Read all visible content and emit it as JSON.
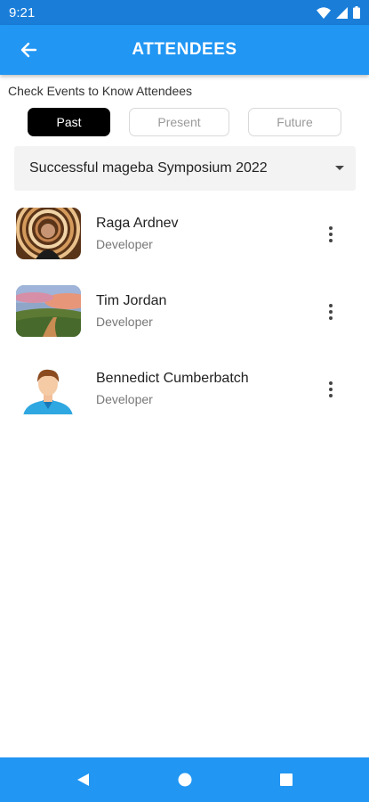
{
  "status_bar": {
    "time": "9:21"
  },
  "app_bar": {
    "title": "ATTENDEES"
  },
  "filter": {
    "hint": "Check Events to Know Attendees",
    "segments": [
      "Past",
      "Present",
      "Future"
    ],
    "selected": "Past"
  },
  "event_select": {
    "value": "Successful mageba Symposium 2022"
  },
  "attendees": [
    {
      "name": "Raga Ardnev",
      "role": "Developer",
      "avatar": "spiral-portrait-photo"
    },
    {
      "name": "Tim Jordan",
      "role": "Developer",
      "avatar": "landscape-sunset-photo"
    },
    {
      "name": "Bennedict Cumberbatch",
      "role": "Developer",
      "avatar": "default-male-avatar"
    }
  ],
  "colors": {
    "primary": "#2196f3",
    "status_bar": "#1a7ed9",
    "selected_segment": "#000000"
  }
}
